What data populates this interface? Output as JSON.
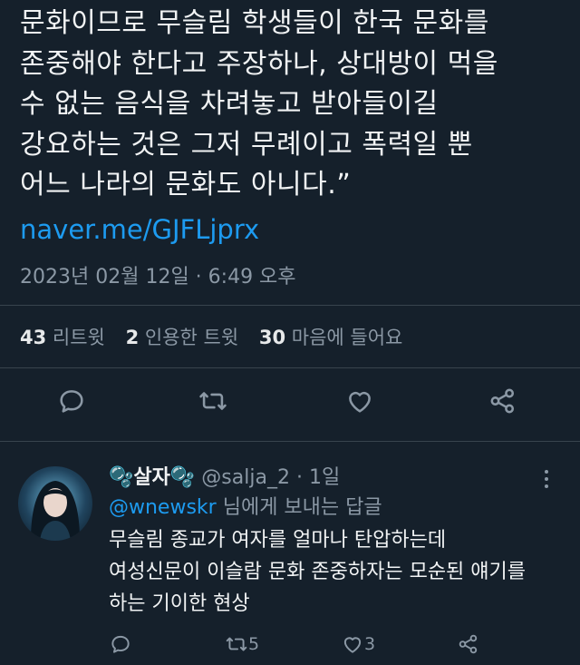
{
  "tweet": {
    "text": "문화이므로 무슬림 학생들이 한국 문화를\n존중해야 한다고 주장하나, 상대방이 먹을\n수 없는 음식을 차려놓고 받아들이길\n강요하는 것은 그저 무례이고 폭력일 뿐\n어느 나라의 문화도 아니다.”",
    "link": "naver.me/GJFLjprx",
    "timestamp": "2023년 02월 12일 · 6:49 오후",
    "stats": {
      "retweets": "43",
      "retweets_label": "리트윗",
      "quotes": "2",
      "quotes_label": "인용한 트윗",
      "likes": "30",
      "likes_label": "마음에 들어요"
    },
    "actions": [
      "reply-icon",
      "retweet-icon",
      "like-icon",
      "share-icon"
    ]
  },
  "reply": {
    "name": "살자",
    "name_emoji": "🫧",
    "handle": "@salja_2",
    "separator": "·",
    "time": "1일",
    "replying_to": "@wnewskr",
    "replying_suffix": " 님에게 보내는 답글",
    "text": "무슬림 종교가 여자를 얼마나 탄압하는데\n여성신문이 이슬람 문화 존중하자는 모순된 얘기를\n하는 기이한 현상",
    "retweet_count": "5",
    "like_count": "3"
  },
  "colors": {
    "background": "#15202b",
    "link": "#1d9bf0",
    "muted": "#8b98a5",
    "divider": "#38444d"
  }
}
